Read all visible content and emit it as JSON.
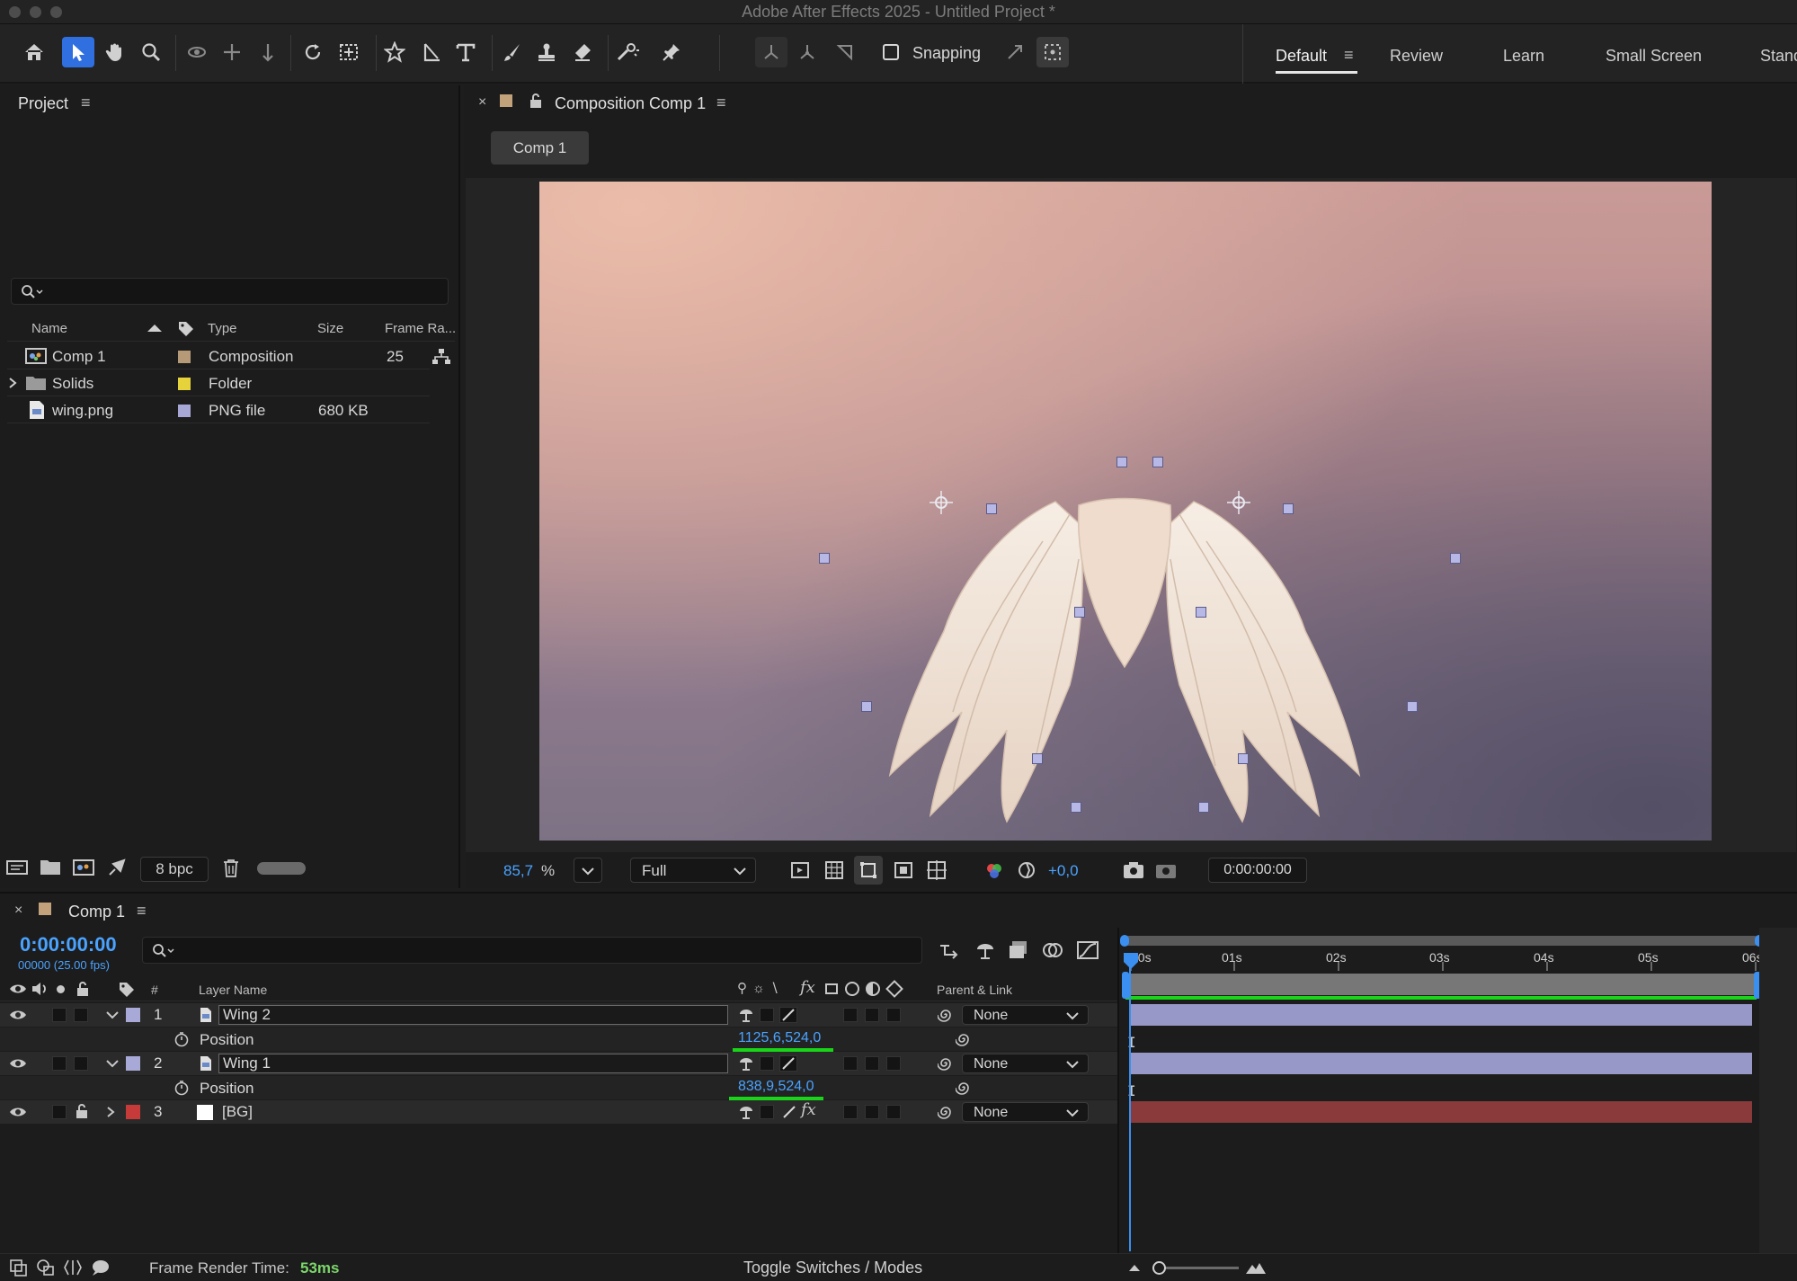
{
  "window": {
    "title": "Adobe After Effects 2025 - Untitled Project *"
  },
  "toolbar": {
    "snapping_label": "Snapping",
    "tools": [
      "home-icon",
      "selection-tool-icon",
      "hand-tool-icon",
      "zoom-tool-icon",
      "orbit-camera-icon",
      "pan-camera-icon",
      "dolly-camera-icon",
      "rotate-tool-icon",
      "pan-behind-icon",
      "shape-star-icon",
      "pen-tool-icon",
      "type-tool-icon",
      "brush-tool-icon",
      "clone-stamp-icon",
      "eraser-tool-icon",
      "roto-brush-icon",
      "puppet-pin-icon"
    ]
  },
  "workspaces": [
    "Default",
    "Review",
    "Learn",
    "Small Screen",
    "Stand"
  ],
  "project": {
    "title": "Project",
    "columns": {
      "name": "Name",
      "type": "Type",
      "size": "Size",
      "frame_rate": "Frame Ra..."
    },
    "items": [
      {
        "name": "Comp 1",
        "type": "Composition",
        "size": "",
        "frame_rate": "25",
        "label_color": "#b69a78"
      },
      {
        "name": "Solids",
        "type": "Folder",
        "size": "",
        "frame_rate": "",
        "label_color": "#e6d23a"
      },
      {
        "name": "wing.png",
        "type": "PNG file",
        "size": "680 KB",
        "frame_rate": "",
        "label_color": "#a7a7d6"
      }
    ],
    "bpc": "8 bpc"
  },
  "composition_panel": {
    "tab_label": "Composition Comp 1",
    "breadcrumb": "Comp 1",
    "zoom": "85,7",
    "zoom_unit": "%",
    "resolution": "Full",
    "exposure": "+0,0",
    "timecode": "0:00:00:00"
  },
  "timeline": {
    "comp_tab": "Comp 1",
    "timecode": "0:00:00:00",
    "frames_fps": "00000 (25.00 fps)",
    "columns": {
      "number": "#",
      "layer_name": "Layer Name",
      "parent": "Parent & Link"
    },
    "ruler_ticks": [
      "00s",
      "01s",
      "02s",
      "03s",
      "04s",
      "05s",
      "06s"
    ],
    "layers": [
      {
        "number": "1",
        "name": "Wing 2",
        "label_color": "#a9a9d8",
        "property": "Position",
        "value": "1125,6,524,0",
        "parent": "None",
        "bar_color": "#9a9ac8"
      },
      {
        "number": "2",
        "name": "Wing 1",
        "label_color": "#a9a9d8",
        "property": "Position",
        "value": "838,9,524,0",
        "parent": "None",
        "bar_color": "#9a9ac8"
      },
      {
        "number": "3",
        "name": "[BG]",
        "label_color": "#c63a3a",
        "parent": "None",
        "bar_color": "#8a3a3a"
      }
    ]
  },
  "status": {
    "frame_render_label": "Frame Render Time:",
    "frame_render_value": "53ms",
    "toggle_label": "Toggle Switches / Modes"
  },
  "colors": {
    "accent_blue": "#2f6fe0",
    "timecode_blue": "#4aa3ff",
    "render_green": "#7bd66b"
  }
}
